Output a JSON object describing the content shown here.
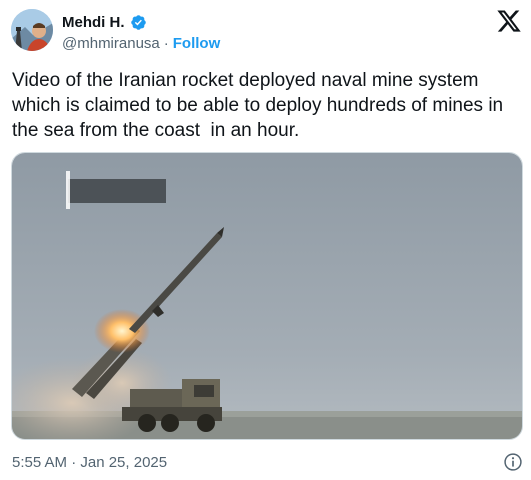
{
  "author": {
    "name": "Mehdi H.",
    "handle": "@mhmiranusa",
    "separator": "·",
    "follow_label": "Follow",
    "verified": true
  },
  "tweet": {
    "text": "Video of the Iranian rocket deployed naval mine system which is claimed to be able to deploy hundreds of mines in the sea from the coast  in an hour.",
    "timestamp": "5:55 AM · Jan 25, 2025"
  },
  "colors": {
    "accent": "#1d9bf0",
    "text": "#0f1419",
    "muted": "#536471"
  },
  "icons": {
    "verified": "verified-badge-icon",
    "platform": "x-logo-icon",
    "info": "info-icon"
  }
}
